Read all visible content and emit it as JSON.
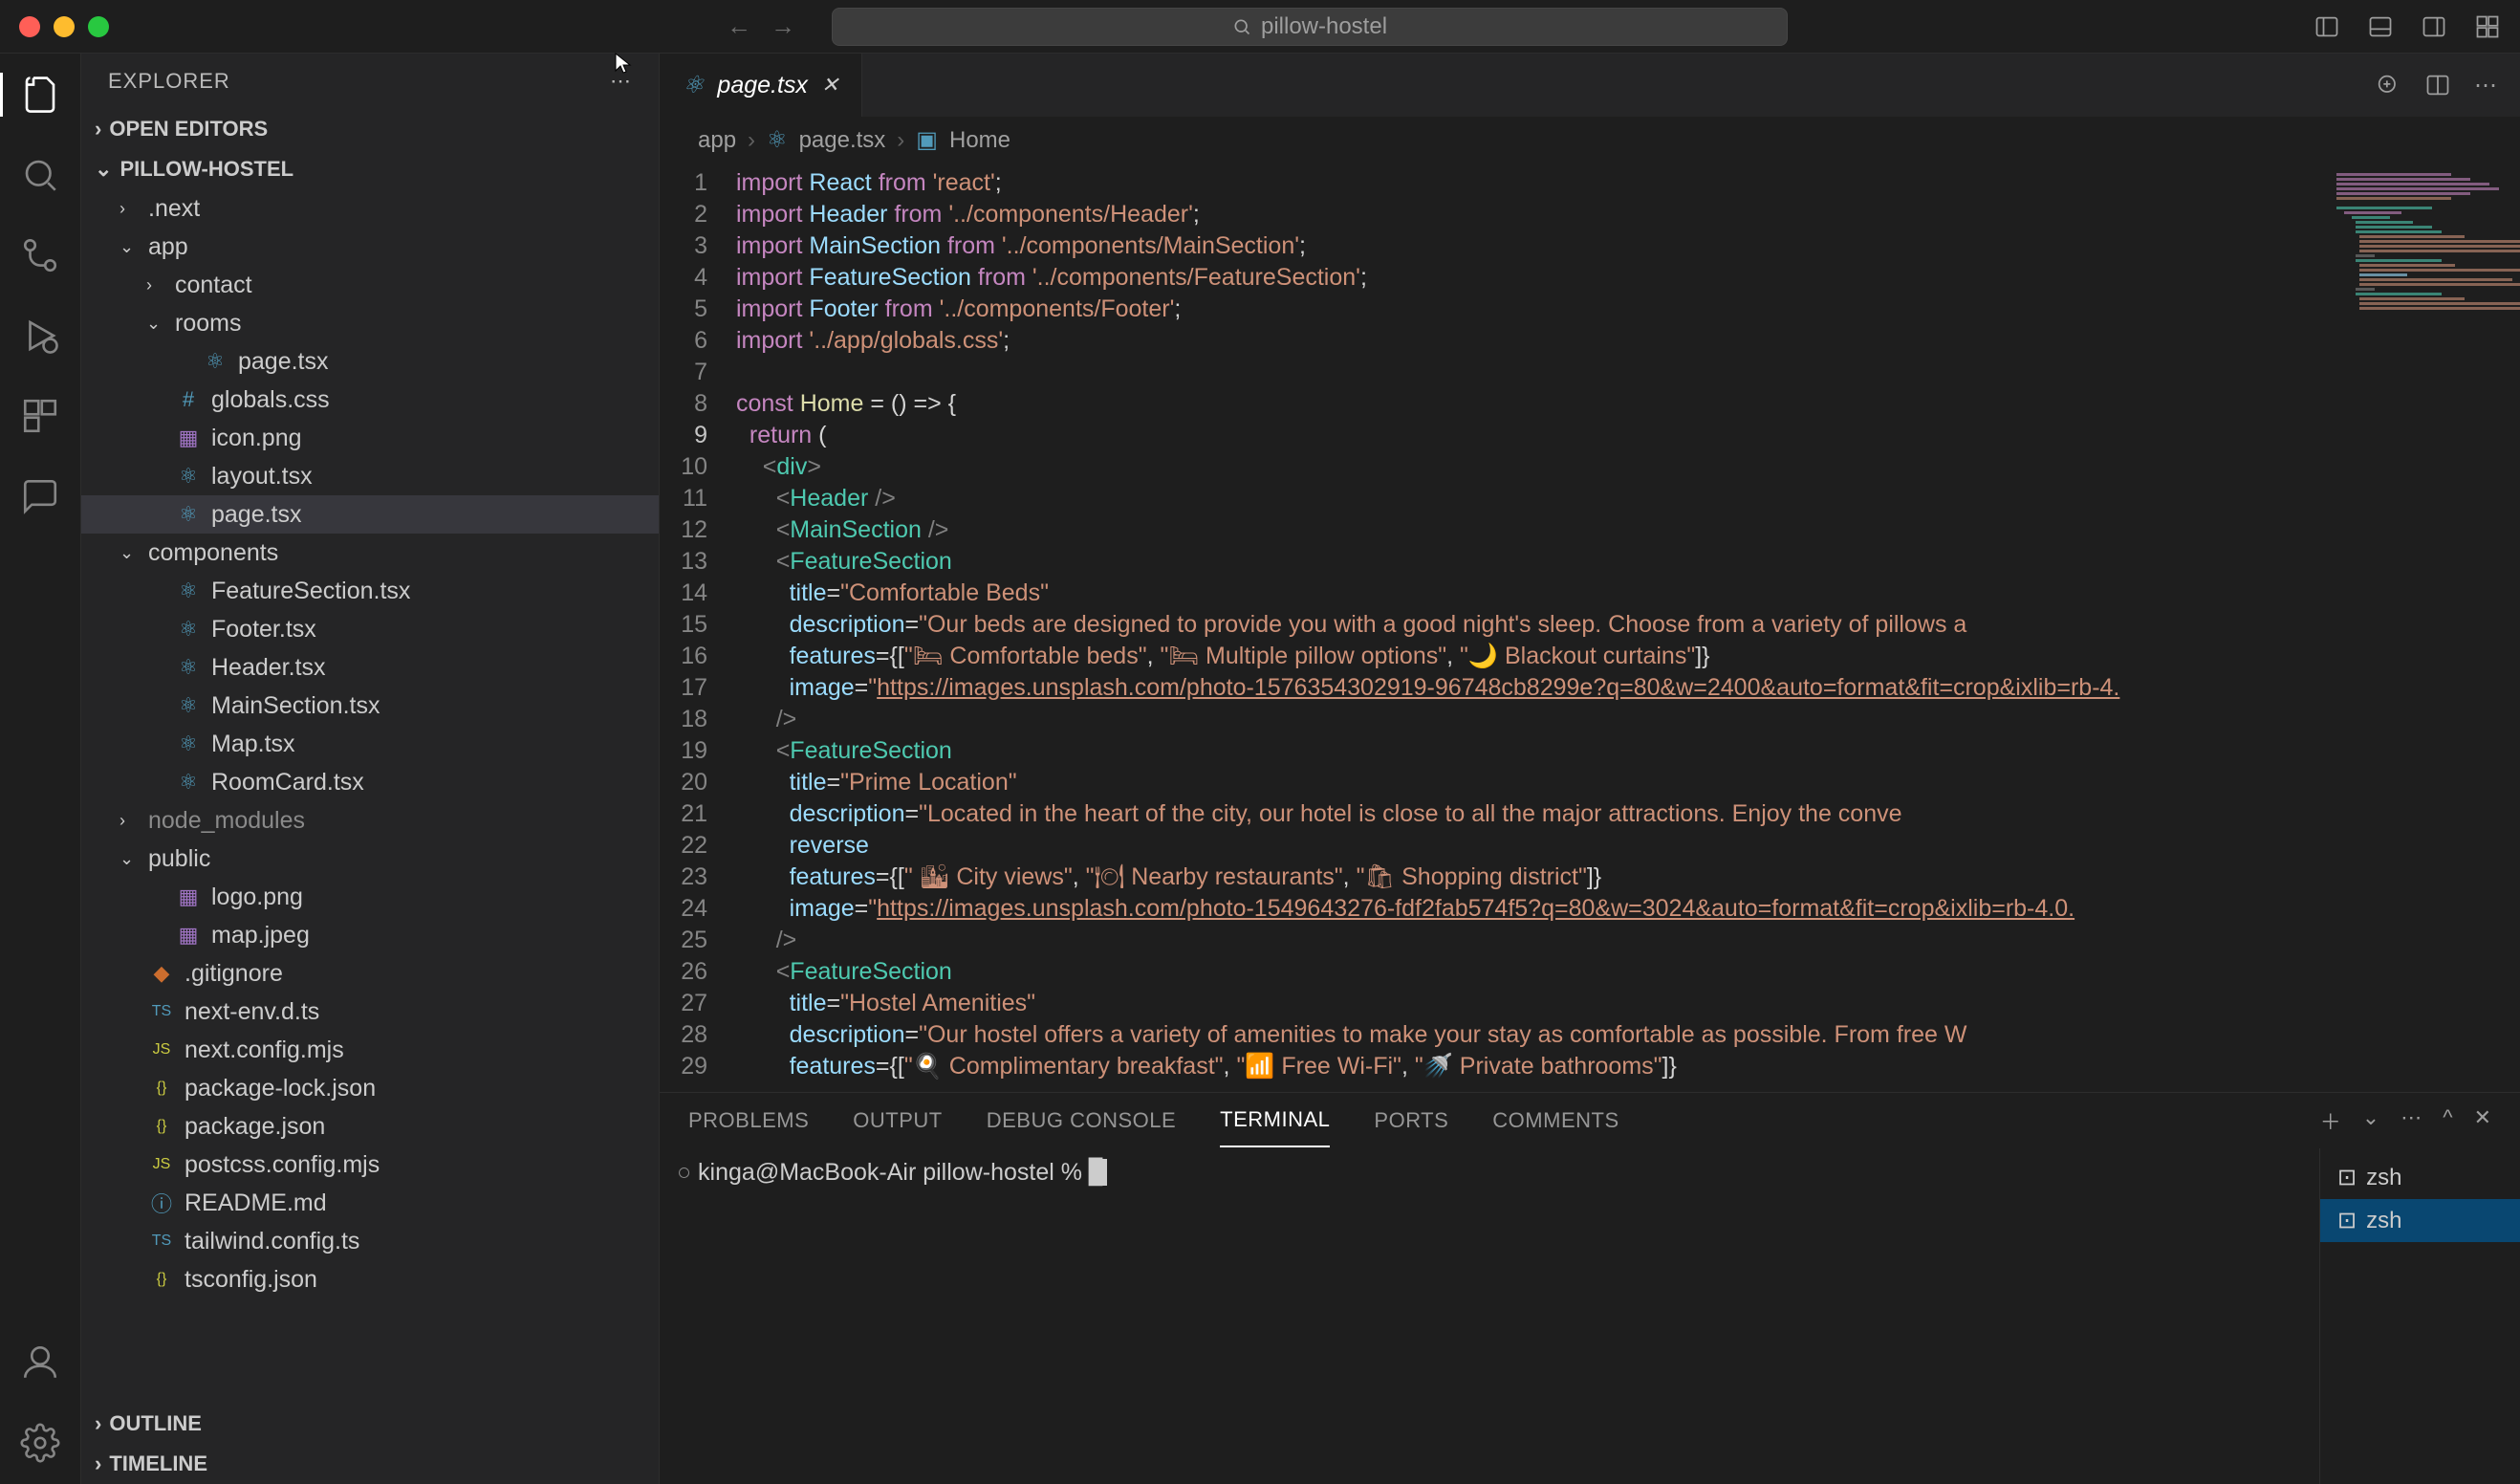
{
  "titlebar": {
    "search": "pillow-hostel"
  },
  "sidebar": {
    "title": "EXPLORER",
    "sections": {
      "openEditors": "OPEN EDITORS",
      "project": "PILLOW-HOSTEL",
      "outline": "OUTLINE",
      "timeline": "TIMELINE"
    },
    "tree": [
      {
        "label": ".next",
        "indent": 1,
        "chev": "›",
        "type": "folder"
      },
      {
        "label": "app",
        "indent": 1,
        "chev": "⌄",
        "type": "folder"
      },
      {
        "label": "contact",
        "indent": 2,
        "chev": "›",
        "type": "folder"
      },
      {
        "label": "rooms",
        "indent": 2,
        "chev": "⌄",
        "type": "folder"
      },
      {
        "label": "page.tsx",
        "indent": 3,
        "icon": "⚛",
        "iconClass": "fc-react",
        "type": "file"
      },
      {
        "label": "globals.css",
        "indent": 2,
        "icon": "#",
        "iconClass": "fc-css",
        "type": "file"
      },
      {
        "label": "icon.png",
        "indent": 2,
        "icon": "▦",
        "iconClass": "fc-img",
        "type": "file"
      },
      {
        "label": "layout.tsx",
        "indent": 2,
        "icon": "⚛",
        "iconClass": "fc-react",
        "type": "file"
      },
      {
        "label": "page.tsx",
        "indent": 2,
        "icon": "⚛",
        "iconClass": "fc-react",
        "type": "file",
        "selected": true
      },
      {
        "label": "components",
        "indent": 1,
        "chev": "⌄",
        "type": "folder"
      },
      {
        "label": "FeatureSection.tsx",
        "indent": 2,
        "icon": "⚛",
        "iconClass": "fc-react",
        "type": "file"
      },
      {
        "label": "Footer.tsx",
        "indent": 2,
        "icon": "⚛",
        "iconClass": "fc-react",
        "type": "file"
      },
      {
        "label": "Header.tsx",
        "indent": 2,
        "icon": "⚛",
        "iconClass": "fc-react",
        "type": "file"
      },
      {
        "label": "MainSection.tsx",
        "indent": 2,
        "icon": "⚛",
        "iconClass": "fc-react",
        "type": "file"
      },
      {
        "label": "Map.tsx",
        "indent": 2,
        "icon": "⚛",
        "iconClass": "fc-react",
        "type": "file"
      },
      {
        "label": "RoomCard.tsx",
        "indent": 2,
        "icon": "⚛",
        "iconClass": "fc-react",
        "type": "file"
      },
      {
        "label": "node_modules",
        "indent": 1,
        "chev": "›",
        "type": "folder",
        "dim": true
      },
      {
        "label": "public",
        "indent": 1,
        "chev": "⌄",
        "type": "folder"
      },
      {
        "label": "logo.png",
        "indent": 2,
        "icon": "▦",
        "iconClass": "fc-img",
        "type": "file"
      },
      {
        "label": "map.jpeg",
        "indent": 2,
        "icon": "▦",
        "iconClass": "fc-img",
        "type": "file"
      },
      {
        "label": ".gitignore",
        "indent": 1,
        "icon": "◆",
        "iconClass": "fc-git",
        "type": "file"
      },
      {
        "label": "next-env.d.ts",
        "indent": 1,
        "icon": "TS",
        "iconClass": "fc-ts",
        "type": "file"
      },
      {
        "label": "next.config.mjs",
        "indent": 1,
        "icon": "JS",
        "iconClass": "fc-js",
        "type": "file"
      },
      {
        "label": "package-lock.json",
        "indent": 1,
        "icon": "{}",
        "iconClass": "fc-json",
        "type": "file"
      },
      {
        "label": "package.json",
        "indent": 1,
        "icon": "{}",
        "iconClass": "fc-json",
        "type": "file"
      },
      {
        "label": "postcss.config.mjs",
        "indent": 1,
        "icon": "JS",
        "iconClass": "fc-js",
        "type": "file"
      },
      {
        "label": "README.md",
        "indent": 1,
        "icon": "ⓘ",
        "iconClass": "fc-md",
        "type": "file"
      },
      {
        "label": "tailwind.config.ts",
        "indent": 1,
        "icon": "TS",
        "iconClass": "fc-ts",
        "type": "file"
      },
      {
        "label": "tsconfig.json",
        "indent": 1,
        "icon": "{}",
        "iconClass": "fc-json",
        "type": "file"
      }
    ]
  },
  "tab": {
    "label": "page.tsx"
  },
  "breadcrumb": {
    "parts": [
      "app",
      "page.tsx",
      "Home"
    ]
  },
  "editor": {
    "currentLine": 9,
    "lines": [
      {
        "n": 1,
        "html": "<span class='kw'>import</span> <span class='var'>React</span> <span class='kw'>from</span> <span class='str'>'react'</span><span class='pun'>;</span>"
      },
      {
        "n": 2,
        "html": "<span class='kw'>import</span> <span class='var'>Header</span> <span class='kw'>from</span> <span class='str'>'../components/Header'</span><span class='pun'>;</span>"
      },
      {
        "n": 3,
        "html": "<span class='kw'>import</span> <span class='var'>MainSection</span> <span class='kw'>from</span> <span class='str'>'../components/MainSection'</span><span class='pun'>;</span>"
      },
      {
        "n": 4,
        "html": "<span class='kw'>import</span> <span class='var'>FeatureSection</span> <span class='kw'>from</span> <span class='str'>'../components/FeatureSection'</span><span class='pun'>;</span>"
      },
      {
        "n": 5,
        "html": "<span class='kw'>import</span> <span class='var'>Footer</span> <span class='kw'>from</span> <span class='str'>'../components/Footer'</span><span class='pun'>;</span>"
      },
      {
        "n": 6,
        "html": "<span class='kw'>import</span> <span class='str'>'../app/globals.css'</span><span class='pun'>;</span>"
      },
      {
        "n": 7,
        "html": ""
      },
      {
        "n": 8,
        "html": "<span class='kw'>const</span> <span class='fn'>Home</span> <span class='pun'>= () =&gt; {</span>"
      },
      {
        "n": 9,
        "html": "  <span class='kw'>return</span> <span class='pun'>(</span>"
      },
      {
        "n": 10,
        "html": "    <span class='jsx'>&lt;</span><span class='type'>div</span><span class='jsx'>&gt;</span>"
      },
      {
        "n": 11,
        "html": "      <span class='jsx'>&lt;</span><span class='comp'>Header</span> <span class='jsx'>/&gt;</span>"
      },
      {
        "n": 12,
        "html": "      <span class='jsx'>&lt;</span><span class='comp'>MainSection</span> <span class='jsx'>/&gt;</span>"
      },
      {
        "n": 13,
        "html": "      <span class='jsx'>&lt;</span><span class='comp'>FeatureSection</span>"
      },
      {
        "n": 14,
        "html": "        <span class='attr'>title</span><span class='pun'>=</span><span class='str'>\"Comfortable Beds\"</span>"
      },
      {
        "n": 15,
        "html": "        <span class='attr'>description</span><span class='pun'>=</span><span class='str'>\"Our beds are designed to provide you with a good night's sleep. Choose from a variety of pillows a</span>"
      },
      {
        "n": 16,
        "html": "        <span class='attr'>features</span><span class='pun'>={[</span><span class='str'>\"🛏 Comfortable beds\"</span><span class='pun'>, </span><span class='str'>\"🛏 Multiple pillow options\"</span><span class='pun'>, </span><span class='str'>\"🌙 Blackout curtains\"</span><span class='pun'>]}</span>"
      },
      {
        "n": 17,
        "html": "        <span class='attr'>image</span><span class='pun'>=</span><span class='str'>\"</span><span class='link'>https://images.unsplash.com/photo-1576354302919-96748cb8299e?q=80&w=2400&auto=format&fit=crop&ixlib=rb-4.</span>"
      },
      {
        "n": 18,
        "html": "      <span class='jsx'>/&gt;</span>"
      },
      {
        "n": 19,
        "html": "      <span class='jsx'>&lt;</span><span class='comp'>FeatureSection</span>"
      },
      {
        "n": 20,
        "html": "        <span class='attr'>title</span><span class='pun'>=</span><span class='str'>\"Prime Location\"</span>"
      },
      {
        "n": 21,
        "html": "        <span class='attr'>description</span><span class='pun'>=</span><span class='str'>\"Located in the heart of the city, our hotel is close to all the major attractions. Enjoy the conve</span>"
      },
      {
        "n": 22,
        "html": "        <span class='attr'>reverse</span>"
      },
      {
        "n": 23,
        "html": "        <span class='attr'>features</span><span class='pun'>={[</span><span class='str'>\" 🏙 City views\"</span><span class='pun'>, </span><span class='str'>\"🍽 Nearby restaurants\"</span><span class='pun'>, </span><span class='str'>\"🛍 Shopping district\"</span><span class='pun'>]}</span>"
      },
      {
        "n": 24,
        "html": "        <span class='attr'>image</span><span class='pun'>=</span><span class='str'>\"</span><span class='link'>https://images.unsplash.com/photo-1549643276-fdf2fab574f5?q=80&w=3024&auto=format&fit=crop&ixlib=rb-4.0.</span>"
      },
      {
        "n": 25,
        "html": "      <span class='jsx'>/&gt;</span>"
      },
      {
        "n": 26,
        "html": "      <span class='jsx'>&lt;</span><span class='comp'>FeatureSection</span>"
      },
      {
        "n": 27,
        "html": "        <span class='attr'>title</span><span class='pun'>=</span><span class='str'>\"Hostel Amenities\"</span>"
      },
      {
        "n": 28,
        "html": "        <span class='attr'>description</span><span class='pun'>=</span><span class='str'>\"Our hostel offers a variety of amenities to make your stay as comfortable as possible. From free W</span>"
      },
      {
        "n": 29,
        "html": "        <span class='attr'>features</span><span class='pun'>={[</span><span class='str'>\"🍳 Complimentary breakfast\"</span><span class='pun'>, </span><span class='str'>\"📶 Free Wi-Fi\"</span><span class='pun'>, </span><span class='str'>\"🚿 Private bathrooms\"</span><span class='pun'>]}</span>"
      }
    ]
  },
  "panel": {
    "tabs": [
      "PROBLEMS",
      "OUTPUT",
      "DEBUG CONSOLE",
      "TERMINAL",
      "PORTS",
      "COMMENTS"
    ],
    "activeTab": "TERMINAL",
    "prompt": "kinga@MacBook-Air pillow-hostel % ",
    "terminals": [
      "zsh",
      "zsh"
    ]
  }
}
